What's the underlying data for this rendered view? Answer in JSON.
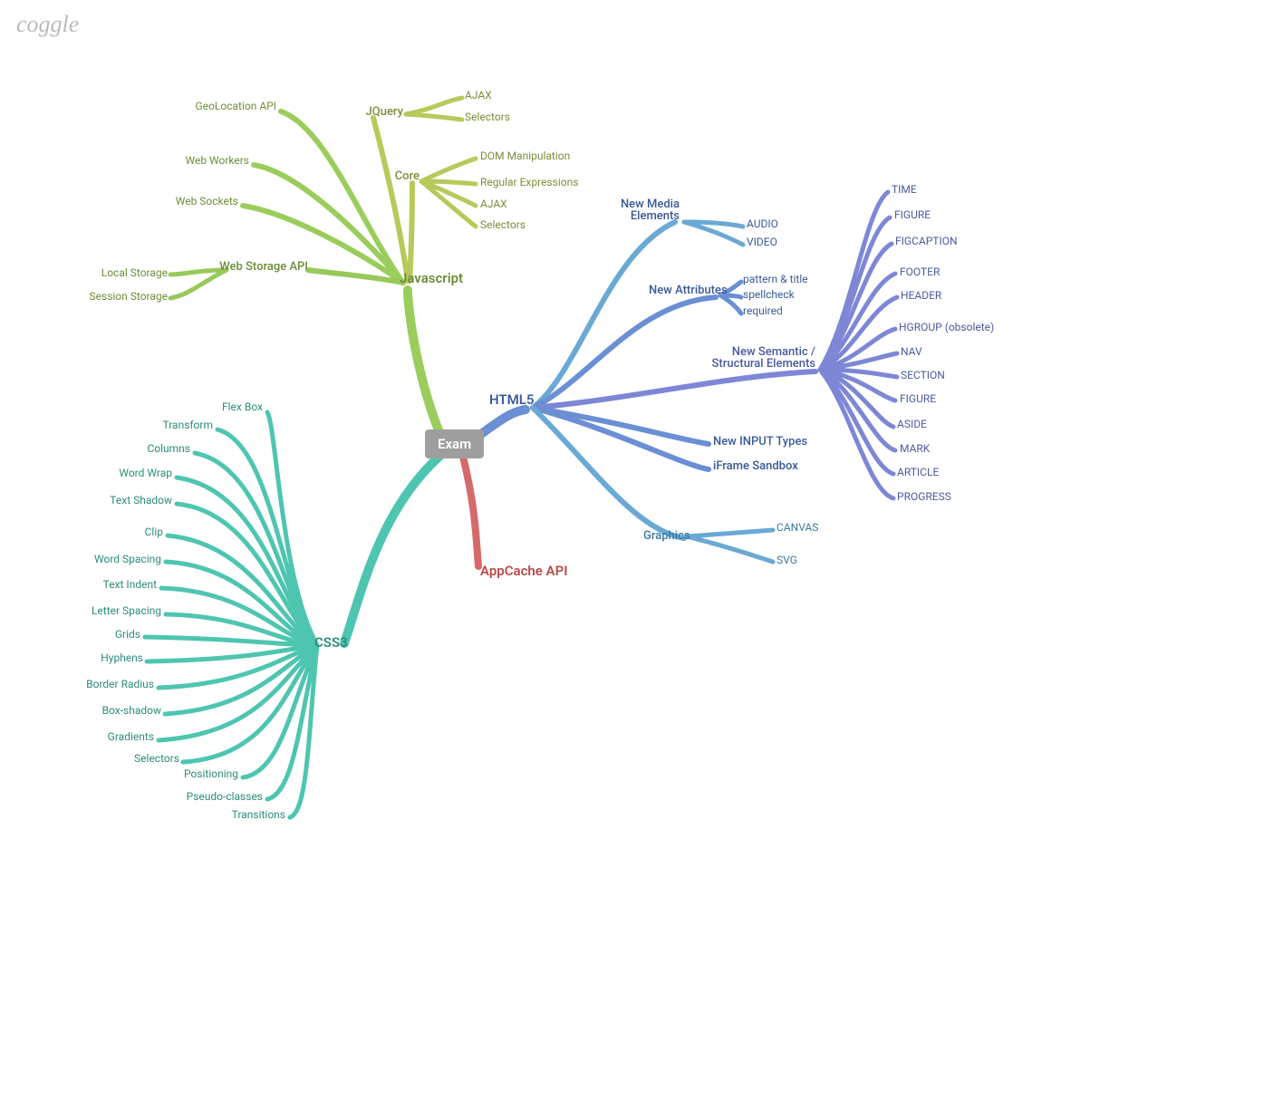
{
  "logo": "coggle",
  "root": "Exam",
  "colors": {
    "js": "#9acd5c",
    "css": "#4ec5b0",
    "html": "#6a8fd4",
    "html2": "#7d87d6",
    "app": "#d66a6a"
  },
  "branches": {
    "js": {
      "label": "Javascript",
      "children": {
        "geo": "GeoLocation API",
        "workers": "Web Workers",
        "sockets": "Web Sockets",
        "storage": {
          "label": "Web Storage API",
          "children": {
            "local": "Local Storage",
            "session": "Session Storage"
          }
        },
        "jquery": {
          "label": "JQuery",
          "children": {
            "ajax": "AJAX",
            "sel": "Selectors"
          }
        },
        "core": {
          "label": "Core",
          "children": {
            "dom": "DOM Manipulation",
            "regex": "Regular Expressions",
            "ajax": "AJAX",
            "sel": "Selectors"
          }
        }
      }
    },
    "css": {
      "label": "CSS3",
      "children": {
        "flex": "Flex Box",
        "transform": "Transform",
        "cols": "Columns",
        "wrap": "Word Wrap",
        "shadow": "Text Shadow",
        "clip": "Clip",
        "wspace": "Word Spacing",
        "indent": "Text Indent",
        "lspace": "Letter Spacing",
        "grids": "Grids",
        "hyph": "Hyphens",
        "radius": "Border Radius",
        "bshadow": "Box-shadow",
        "grad": "Gradients",
        "sel": "Selectors",
        "pos": "Positioning",
        "pseudo": "Pseudo-classes",
        "trans": "Transitions"
      }
    },
    "html": {
      "label": "HTML5",
      "children": {
        "media": {
          "label_line1": "New Media",
          "label_line2": "Elements",
          "children": {
            "audio": "AUDIO",
            "video": "VIDEO"
          }
        },
        "attr": {
          "label": "New Attributes",
          "children": {
            "pattern": "pattern & title",
            "spell": "spellcheck",
            "req": "required"
          }
        },
        "sem": {
          "label_line1": "New Semantic /",
          "label_line2": "Structural Elements",
          "children": {
            "time": "TIME",
            "fig": "FIGURE",
            "figc": "FIGCAPTION",
            "footer": "FOOTER",
            "header": "HEADER",
            "hgroup": "HGROUP (obsolete)",
            "nav": "NAV",
            "section": "SECTION",
            "fig2": "FIGURE",
            "aside": "ASIDE",
            "mark": "MARK",
            "article": "ARTICLE",
            "prog": "PROGRESS"
          }
        },
        "input": "New INPUT Types",
        "iframe": "iFrame Sandbox",
        "gfx": {
          "label": "Graphics",
          "children": {
            "canvas": "CANVAS",
            "svg": "SVG"
          }
        }
      }
    },
    "app": {
      "label": "AppCache API"
    }
  }
}
